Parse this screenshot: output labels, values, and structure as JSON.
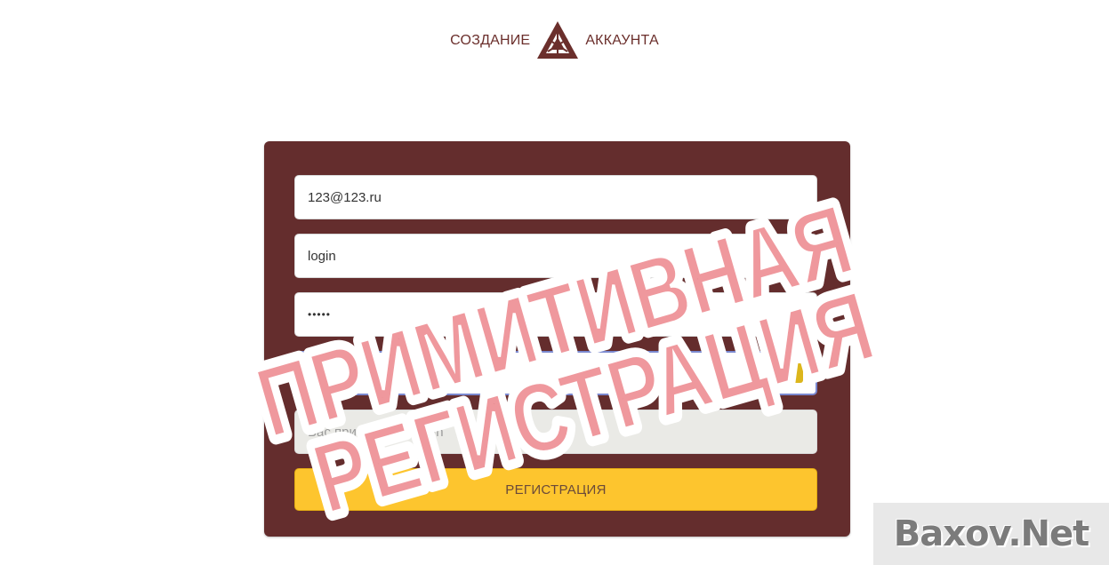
{
  "header": {
    "left_text": "СОЗДАНИЕ",
    "right_text": "АККАУНТА",
    "logo_icon": "triangle-emblem-icon"
  },
  "form": {
    "email_value": "123@123.ru",
    "login_value": "login",
    "password_value": "•••••",
    "password_confirm_value": "•••••",
    "invited_by_value": "Вас пригласил: Admin",
    "submit_label": "РЕГИСТРАЦИЯ",
    "password_manager_icon": "key-icon"
  },
  "overlay": {
    "stamp_line1": "ПРИМИТИВНАЯ",
    "stamp_line2": "РЕГИСТРАЦИЯ",
    "watermark": "Baxov.Net"
  },
  "colors": {
    "panel": "#642d2d",
    "button": "#fdc52e",
    "stamp": "#d6323a"
  }
}
